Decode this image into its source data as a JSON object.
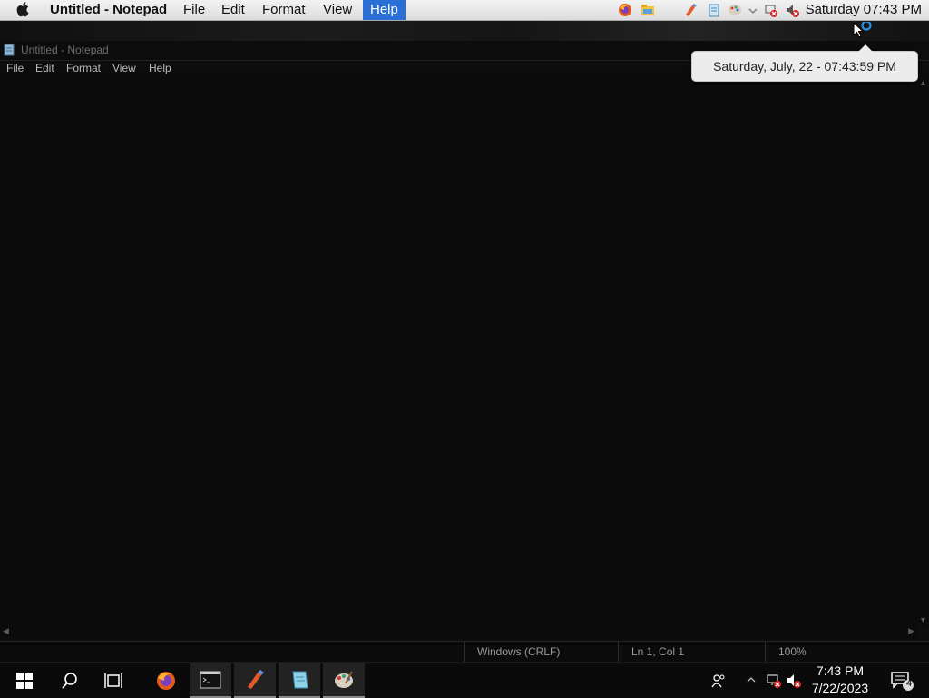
{
  "macbar": {
    "app_title": "Untitled - Notepad",
    "menus": [
      "File",
      "Edit",
      "Format",
      "View",
      "Help"
    ],
    "highlighted_menu": "Help",
    "clock": "Saturday 07:43 PM"
  },
  "tooltip": {
    "text": "Saturday, July, 22 - 07:43:59 PM"
  },
  "notepad": {
    "title": "Untitled - Notepad",
    "menus": [
      "File",
      "Edit",
      "Format",
      "View",
      "Help"
    ],
    "content": "",
    "status": {
      "line_ending": "Windows (CRLF)",
      "position": "Ln 1, Col 1",
      "zoom": "100%"
    }
  },
  "taskbar": {
    "apps": [
      "start-icon",
      "search-icon",
      "task-view-icon",
      "firefox-icon",
      "terminal-icon",
      "paint-brush-icon",
      "notepad-icon",
      "paint-palette-icon"
    ],
    "time": "7:43 PM",
    "date": "7/22/2023",
    "notification_count": "4"
  },
  "colors": {
    "menu_highlight": "#2a6fd6",
    "window_bg": "#0b0b0b",
    "tooltip_bg": "#ececec"
  }
}
